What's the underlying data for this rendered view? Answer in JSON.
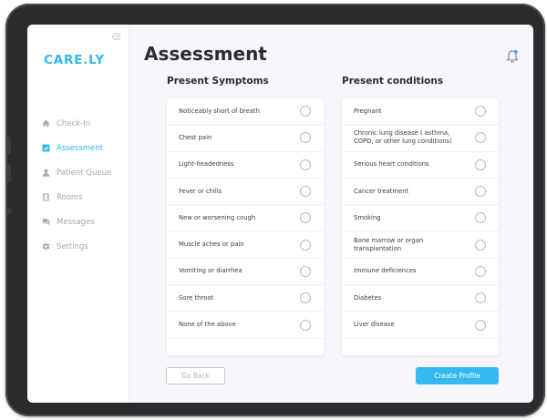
{
  "app": {
    "logo": "CARE.LY",
    "accent_color": "#30b8ea"
  },
  "sidebar": {
    "items": [
      {
        "label": "Check-In",
        "icon": "home-icon",
        "active": false
      },
      {
        "label": "Assessment",
        "icon": "checkbox-icon",
        "active": true
      },
      {
        "label": "Patient Queue",
        "icon": "user-icon",
        "active": false
      },
      {
        "label": "Rooms",
        "icon": "door-icon",
        "active": false
      },
      {
        "label": "Messages",
        "icon": "chat-icon",
        "active": false
      },
      {
        "label": "Settings",
        "icon": "gear-icon",
        "active": false
      }
    ]
  },
  "header": {
    "title": "Assessment",
    "notification_icon": "bell-icon"
  },
  "symptoms": {
    "title": "Present Symptoms",
    "items": [
      "Noticeably short of breath",
      "Chest pain",
      "Light-headedness",
      "Fever or chills",
      "New or worsening cough",
      "Muscle aches or pain",
      "Vomiting or diarrhea",
      "Sore throat",
      "None of the above"
    ]
  },
  "conditions": {
    "title": "Present conditions",
    "items": [
      "Pregnant",
      "Chronic lung disease ( asthma, COPD, or other lung conditions)",
      "Serious heart conditions",
      "Cancer treatment",
      "Smoking",
      "Bone marrow or organ transplantation",
      "Immune deficiences",
      "Diabetes",
      "Liver disease"
    ]
  },
  "actions": {
    "back_label": "Go Back",
    "create_label": "Create Profile"
  }
}
